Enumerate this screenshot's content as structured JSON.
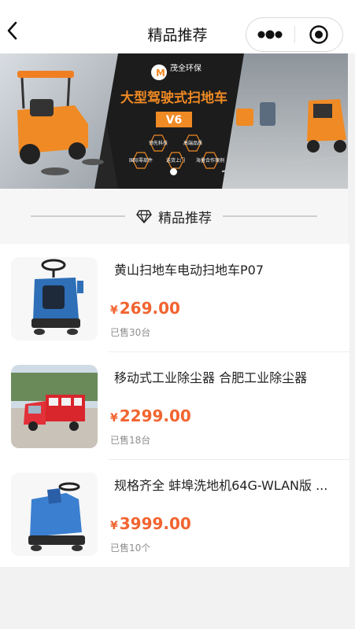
{
  "nav": {
    "title": "精品推荐"
  },
  "banner": {
    "brand_name": "茂全环保",
    "headline": "大型驾驶式扫地车",
    "model": "V6",
    "features": [
      "领先科技",
      "高端品质",
      "国际零部件",
      "送货上门",
      "海量合作案例"
    ]
  },
  "section": {
    "title": "精品推荐"
  },
  "products": [
    {
      "title": "黄山扫地车电动扫地车P07",
      "price_symbol": "¥",
      "price": "269.00",
      "sold": "已售30台"
    },
    {
      "title": "移动式工业除尘器 合肥工业除尘器",
      "price_symbol": "¥",
      "price": "2299.00",
      "sold": "已售18台"
    },
    {
      "title": "规格齐全 蚌埠洗地机64G-WLAN版 ...",
      "price_symbol": "¥",
      "price": "3999.00",
      "sold": "已售10个"
    }
  ],
  "colors": {
    "price": "#f26430",
    "banner_accent": "#f08a24"
  }
}
